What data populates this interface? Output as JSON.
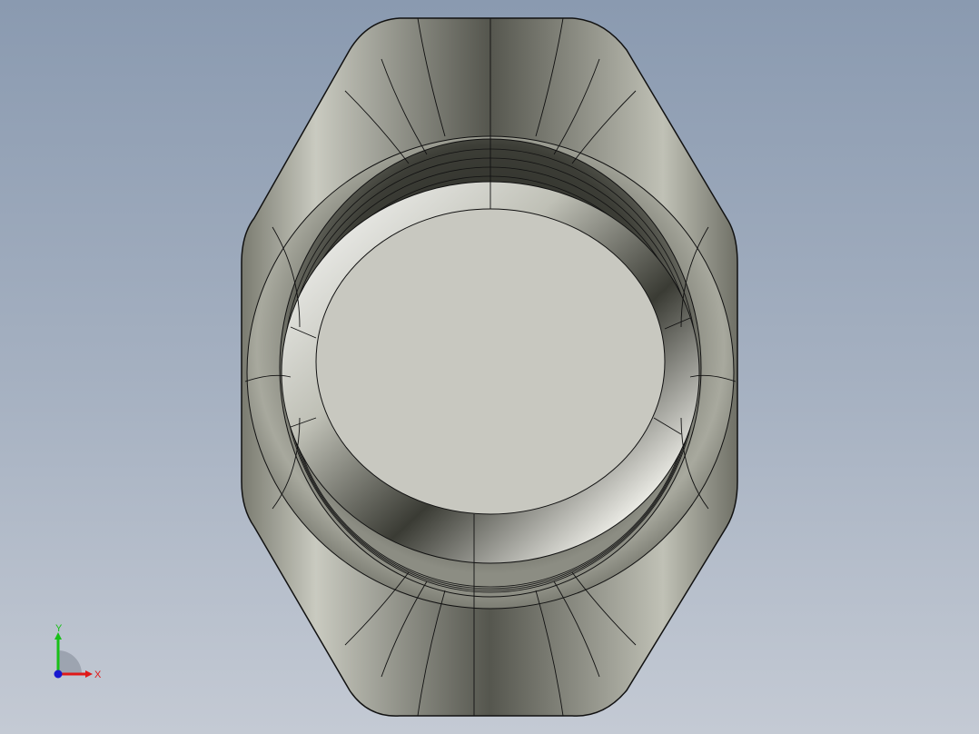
{
  "viewport": {
    "background_top": "#8a9ab0",
    "background_bottom": "#c4cad4"
  },
  "model": {
    "body_color": "#4e5048",
    "edge_color": "#111111",
    "face_color": "#c8c8c0",
    "rim_highlight": "#f4f4f0"
  },
  "triad": {
    "x_label": "X",
    "y_label": "Y",
    "x_color": "#e01818",
    "y_color": "#18c018",
    "z_color": "#1818d0"
  }
}
